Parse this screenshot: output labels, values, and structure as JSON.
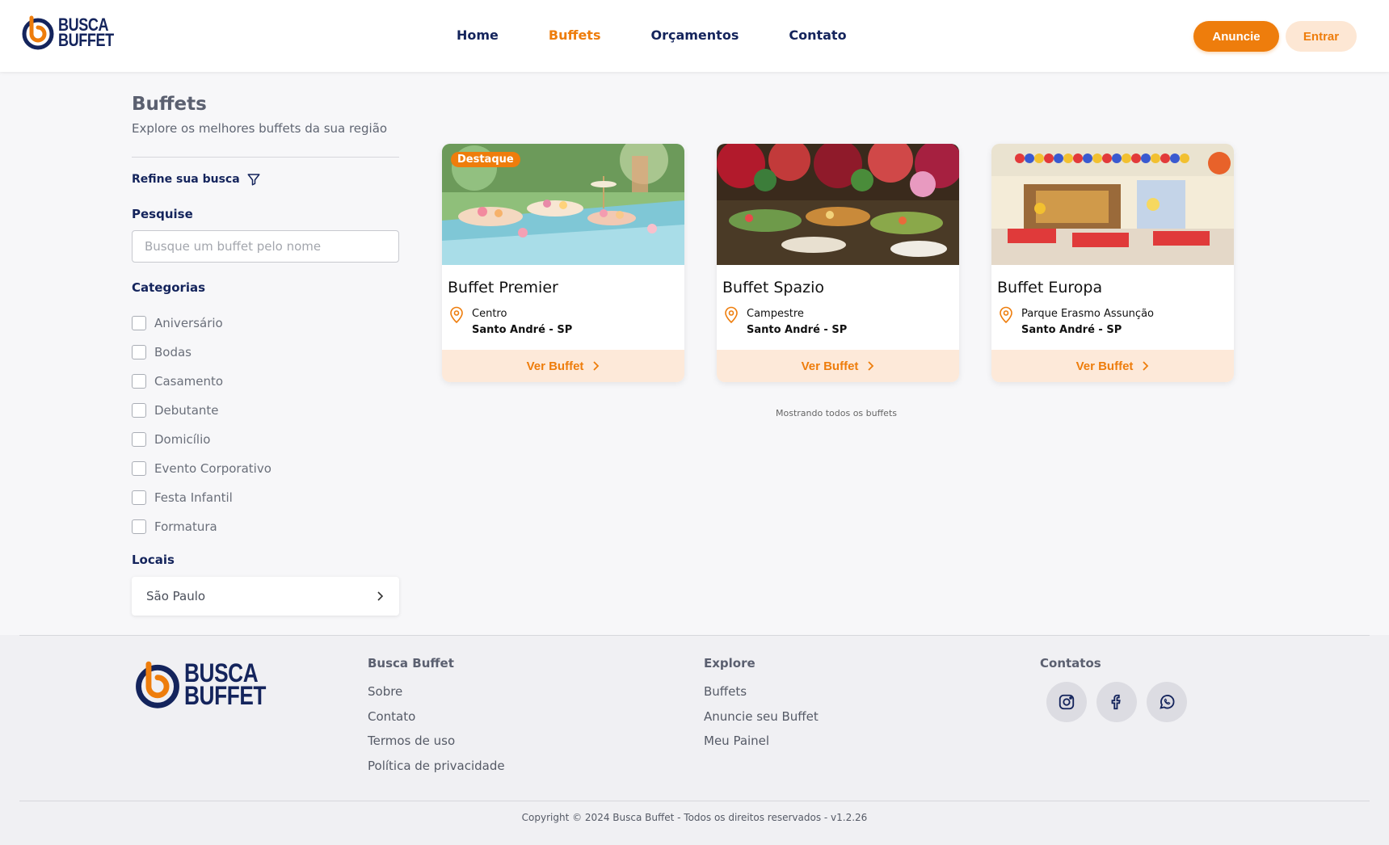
{
  "brand": {
    "name_line1": "BUSCA",
    "name_line2": "BUFFET"
  },
  "nav": {
    "items": [
      {
        "label": "Home"
      },
      {
        "label": "Buffets"
      },
      {
        "label": "Orçamentos"
      },
      {
        "label": "Contato"
      }
    ],
    "active": "Buffets"
  },
  "header_actions": {
    "anuncie": "Anuncie",
    "entrar": "Entrar"
  },
  "page": {
    "title": "Buffets",
    "subtitle": "Explore os melhores buffets da sua região"
  },
  "filters": {
    "refine_label": "Refine sua busca",
    "search_label": "Pesquise",
    "search_placeholder": "Busque um buffet pelo nome",
    "categories_label": "Categorias",
    "categories": [
      "Aniversário",
      "Bodas",
      "Casamento",
      "Debutante",
      "Domicílio",
      "Evento Corporativo",
      "Festa Infantil",
      "Formatura"
    ],
    "locais_label": "Locais",
    "local_selected": "São Paulo"
  },
  "buffets": [
    {
      "name": "Buffet Premier",
      "badge": "Destaque",
      "neighborhood": "Centro",
      "city": "Santo André - SP",
      "button": "Ver Buffet"
    },
    {
      "name": "Buffet Spazio",
      "neighborhood": "Campestre",
      "city": "Santo André - SP",
      "button": "Ver Buffet"
    },
    {
      "name": "Buffet Europa",
      "neighborhood": "Parque Erasmo Assunção",
      "city": "Santo André - SP",
      "button": "Ver Buffet"
    }
  ],
  "results_note": "Mostrando todos os buffets",
  "footer": {
    "col1": {
      "title": "Busca Buffet",
      "links": [
        "Sobre",
        "Contato",
        "Termos de uso",
        "Política de privacidade"
      ]
    },
    "col2": {
      "title": "Explore",
      "links": [
        "Buffets",
        "Anuncie seu Buffet",
        "Meu Painel"
      ]
    },
    "col3": {
      "title": "Contatos",
      "socials": [
        "instagram-icon",
        "facebook-icon",
        "whatsapp-icon"
      ]
    },
    "copyright": "Copyright © 2024 Busca Buffet - Todos os direitos reservados - v1.2.26"
  },
  "colors": {
    "accent": "#ee7d0c",
    "navy": "#14245c",
    "accent_light": "#fde9d9"
  }
}
